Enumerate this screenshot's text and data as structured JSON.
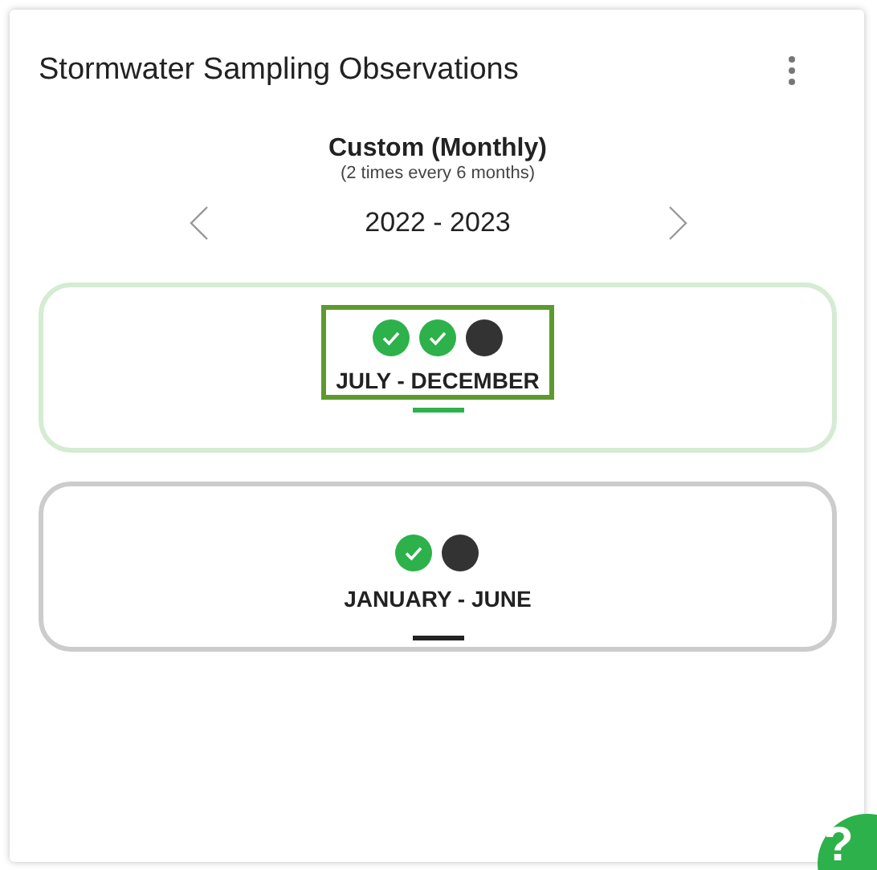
{
  "card": {
    "title": "Stormwater Sampling Observations"
  },
  "schedule": {
    "name": "Custom (Monthly)",
    "frequency": "(2 times every 6 months)"
  },
  "year_nav": {
    "range": "2022 - 2023"
  },
  "periods": [
    {
      "label": "JULY - DECEMBER",
      "selected": true,
      "focused": true,
      "samples": [
        {
          "done": true
        },
        {
          "done": true
        },
        {
          "done": false
        }
      ]
    },
    {
      "label": "JANUARY - JUNE",
      "selected": false,
      "focused": false,
      "samples": [
        {
          "done": true
        },
        {
          "done": false
        }
      ]
    }
  ],
  "help_button": {
    "label": "?"
  }
}
